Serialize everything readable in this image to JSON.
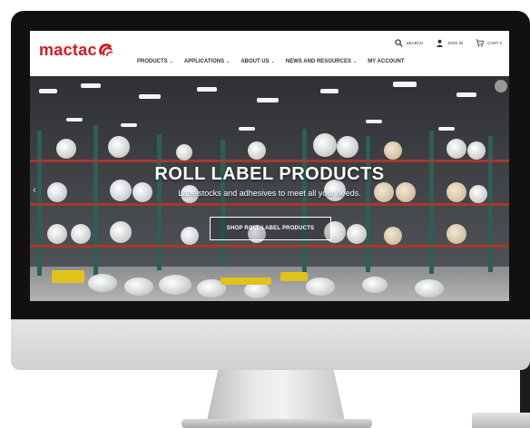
{
  "brand": {
    "name": "mactac",
    "color": "#d71920"
  },
  "utility": {
    "search_label": "SEARCH",
    "signin_label": "SIGN IN",
    "cart_label": "CART 0"
  },
  "nav": {
    "items": [
      {
        "label": "PRODUCTS"
      },
      {
        "label": "APPLICATIONS"
      },
      {
        "label": "ABOUT US"
      },
      {
        "label": "NEWS AND RESOURCES"
      },
      {
        "label": "MY ACCOUNT"
      }
    ]
  },
  "hero": {
    "title": "ROLL LABEL PRODUCTS",
    "subtitle": "Labelstocks and adhesives to meet all your needs.",
    "cta_label": "SHOP ROLL LABEL PRODUCTS"
  },
  "icons": {
    "search": "magnifier-icon",
    "user": "user-icon",
    "cart": "cart-icon",
    "dropdown": "chevron-down-icon",
    "carousel_prev": "chevron-left-icon"
  }
}
